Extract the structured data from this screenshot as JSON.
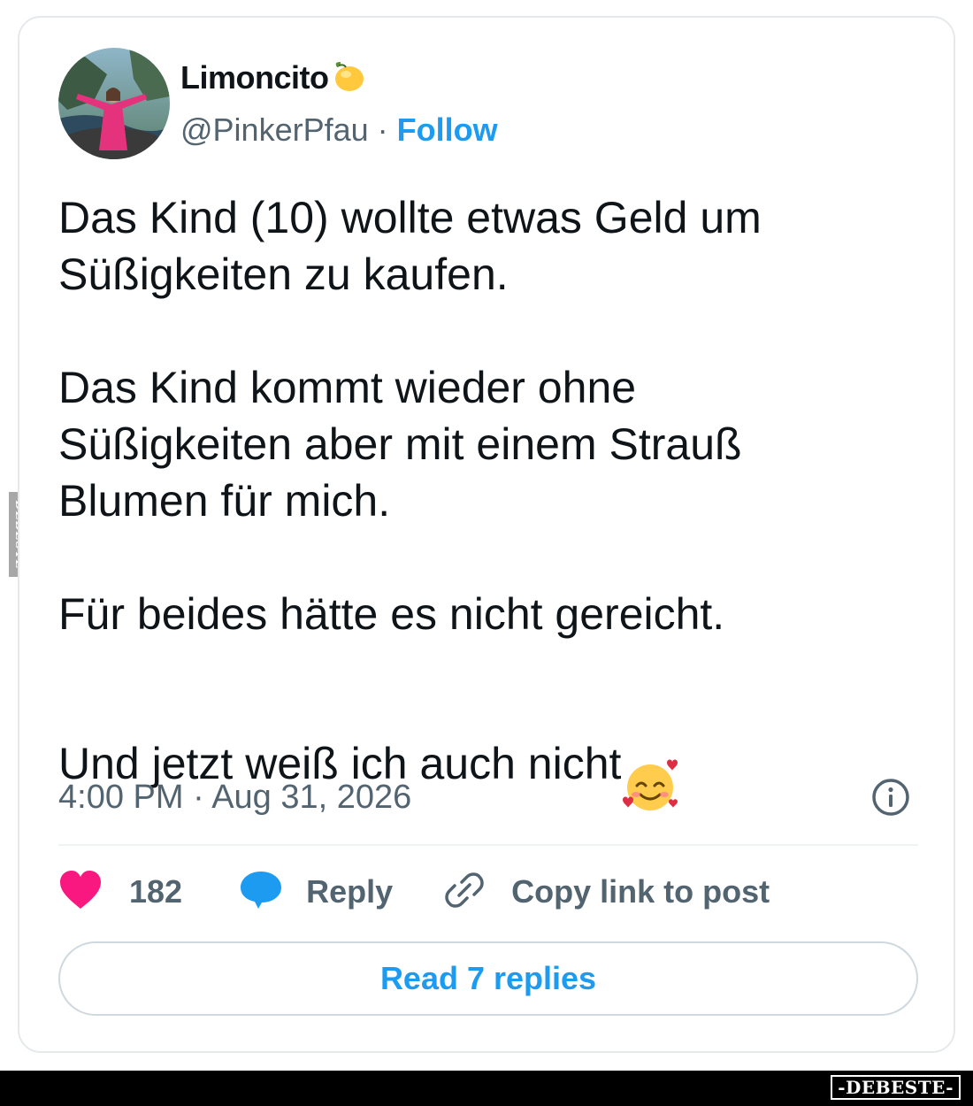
{
  "tweet": {
    "display_name": "Limoncito",
    "handle": "@PinkerPfau",
    "separator": " · ",
    "follow_label": "Follow",
    "paragraphs": [
      "Das Kind (10) wollte etwas Geld um\nSüßigkeiten zu kaufen.",
      "Das Kind kommt wieder ohne\nSüßigkeiten aber mit einem Strauß\nBlumen für mich.",
      "Für beides hätte es nicht gereicht."
    ],
    "last_line": "Und jetzt weiß ich auch nicht",
    "timestamp": "4:00 PM · Aug 31, 2026",
    "like_count": "182",
    "reply_label": "Reply",
    "copy_link_label": "Copy link to post",
    "read_replies_label": "Read 7 replies"
  },
  "icons": {
    "name_badge": "lemon-emoji",
    "text_emoji": "smiling-face-with-hearts-emoji",
    "info": "info-icon",
    "like": "heart-icon",
    "reply": "speech-bubble-icon",
    "copy_link": "link-icon"
  },
  "colors": {
    "link_blue": "#1d9bf0",
    "text": "#0f1419",
    "secondary_text": "#536471",
    "heart_pink": "#f91880",
    "border": "#cfd9de"
  },
  "watermark": {
    "side_text": "DEBESTE",
    "footer_text": "-DEBESTE-"
  }
}
